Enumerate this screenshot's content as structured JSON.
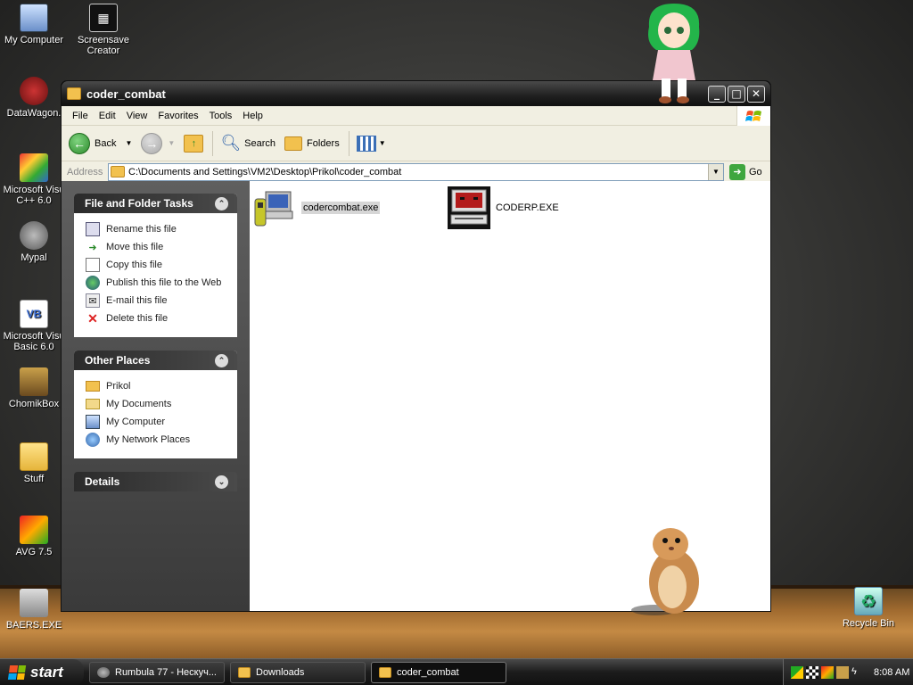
{
  "desktop": {
    "icons": [
      {
        "label": "My Computer"
      },
      {
        "label": "Screensave Creator"
      },
      {
        "label": "DataWagon."
      },
      {
        "label": "Microsoft Visu C++ 6.0"
      },
      {
        "label": "Mypal"
      },
      {
        "label": "Microsoft Visu Basic 6.0"
      },
      {
        "label": "ChomikBox"
      },
      {
        "label": "Stuff"
      },
      {
        "label": "AVG 7.5"
      },
      {
        "label": "BAERS.EXE"
      },
      {
        "label": "Recycle Bin"
      }
    ]
  },
  "window": {
    "title": "coder_combat",
    "menu": [
      "File",
      "Edit",
      "View",
      "Favorites",
      "Tools",
      "Help"
    ],
    "toolbar": {
      "back_label": "Back",
      "search_label": "Search",
      "folders_label": "Folders"
    },
    "address": {
      "label": "Address",
      "value": "C:\\Documents and Settings\\VM2\\Desktop\\Prikol\\coder_combat",
      "go_label": "Go"
    },
    "file_tasks": {
      "title": "File and Folder Tasks",
      "items": [
        "Rename this file",
        "Move this file",
        "Copy this file",
        "Publish this file to the Web",
        "E-mail this file",
        "Delete this file"
      ]
    },
    "other_places": {
      "title": "Other Places",
      "items": [
        "Prikol",
        "My Documents",
        "My Computer",
        "My Network Places"
      ]
    },
    "details": {
      "title": "Details"
    },
    "files": [
      {
        "name": "codercombat.exe",
        "selected": true
      },
      {
        "name": "CODERP.EXE",
        "selected": false
      }
    ]
  },
  "taskbar": {
    "start_label": "start",
    "tasks": [
      {
        "label": "Rumbula 77 - Нескуч...",
        "active": false
      },
      {
        "label": "Downloads",
        "active": false
      },
      {
        "label": "coder_combat",
        "active": true
      }
    ],
    "clock": "8:08 AM"
  }
}
